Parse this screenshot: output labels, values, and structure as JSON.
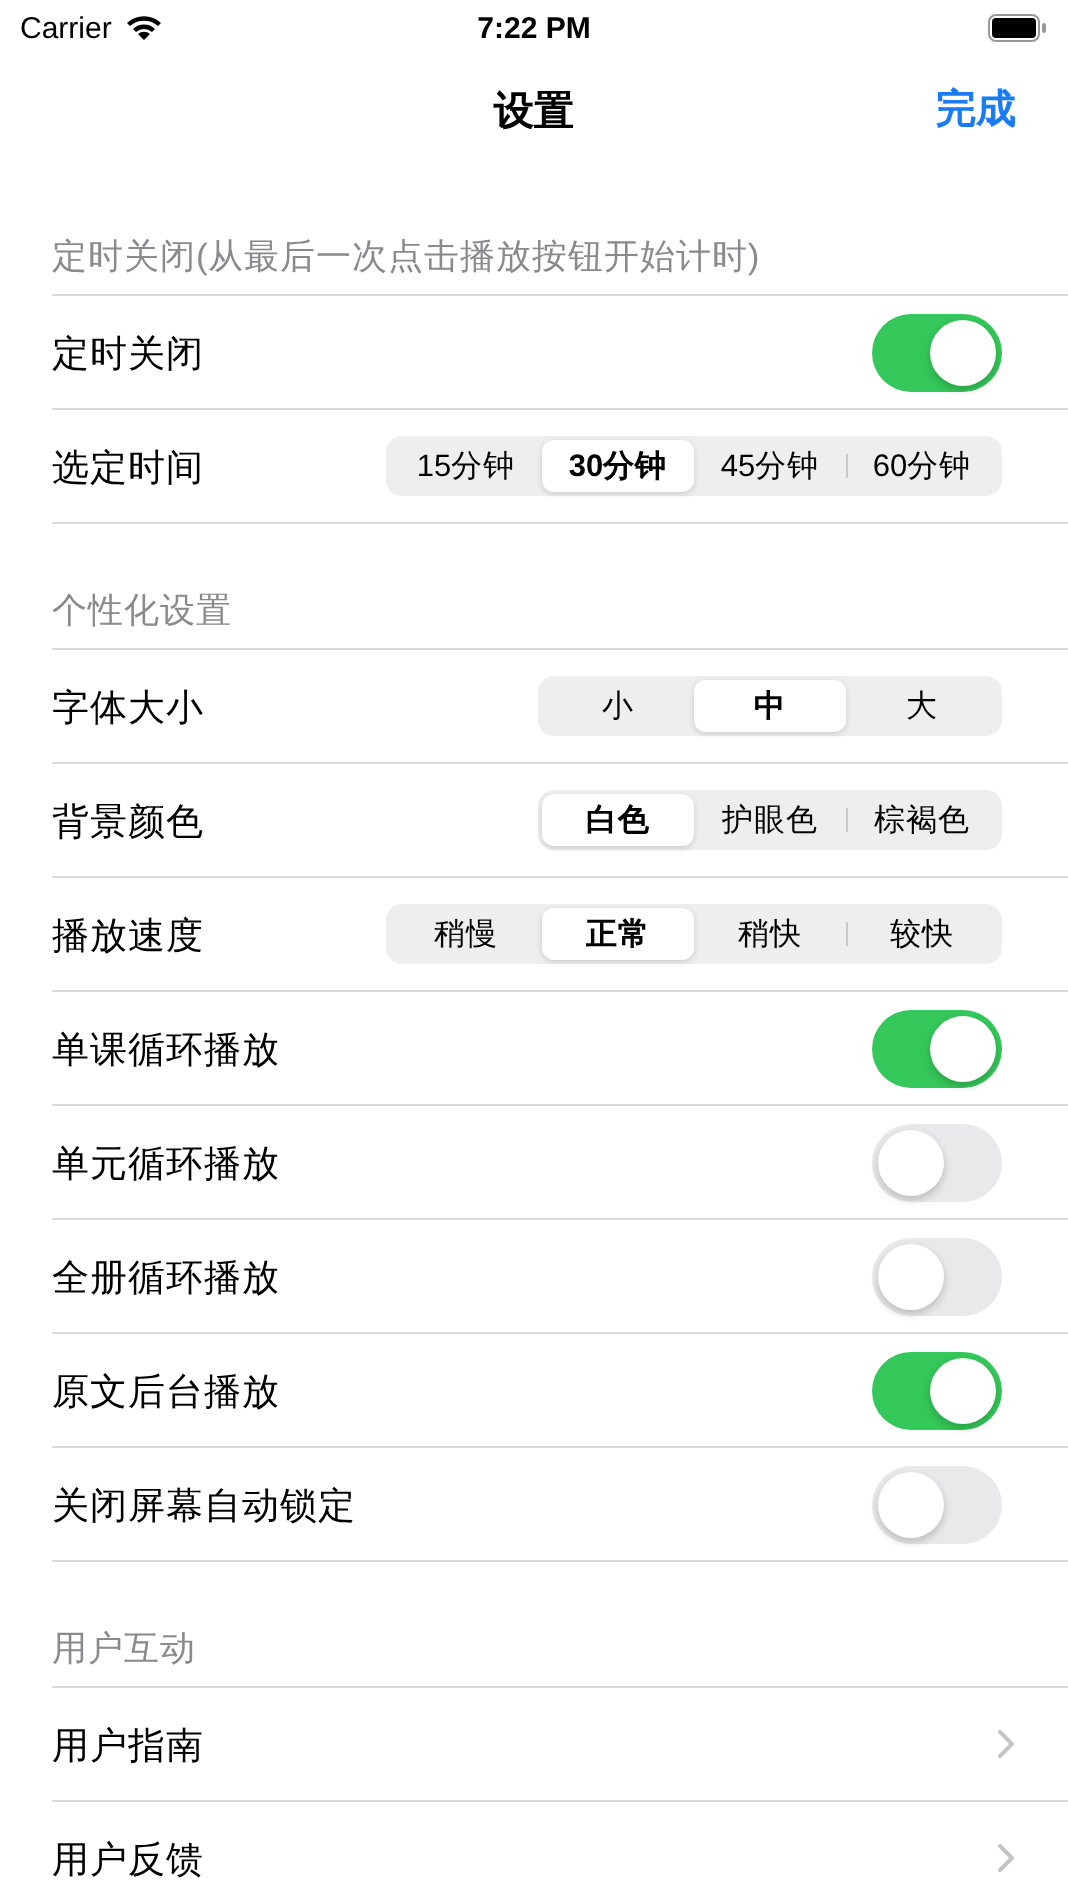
{
  "status_bar": {
    "carrier": "Carrier",
    "time": "7:22 PM"
  },
  "nav": {
    "title": "设置",
    "done": "完成"
  },
  "sections": [
    {
      "header": "定时关闭(从最后一次点击播放按钮开始计时)",
      "rows": [
        {
          "kind": "toggle",
          "label": "定时关闭",
          "on": true
        },
        {
          "kind": "segmented",
          "label": "选定时间",
          "options": [
            {
              "label": "15分钟",
              "selected": false
            },
            {
              "label": "30分钟",
              "selected": true
            },
            {
              "label": "45分钟",
              "selected": false
            },
            {
              "label": "60分钟",
              "selected": false
            }
          ]
        }
      ]
    },
    {
      "header": "个性化设置",
      "rows": [
        {
          "kind": "segmented",
          "label": "字体大小",
          "options": [
            {
              "label": "小",
              "selected": false
            },
            {
              "label": "中",
              "selected": true
            },
            {
              "label": "大",
              "selected": false
            }
          ]
        },
        {
          "kind": "segmented",
          "label": "背景颜色",
          "options": [
            {
              "label": "白色",
              "selected": true
            },
            {
              "label": "护眼色",
              "selected": false
            },
            {
              "label": "棕褐色",
              "selected": false
            }
          ]
        },
        {
          "kind": "segmented",
          "label": "播放速度",
          "options": [
            {
              "label": "稍慢",
              "selected": false
            },
            {
              "label": "正常",
              "selected": true
            },
            {
              "label": "稍快",
              "selected": false
            },
            {
              "label": "较快",
              "selected": false
            }
          ]
        },
        {
          "kind": "toggle",
          "label": "单课循环播放",
          "on": true
        },
        {
          "kind": "toggle",
          "label": "单元循环播放",
          "on": false
        },
        {
          "kind": "toggle",
          "label": "全册循环播放",
          "on": false
        },
        {
          "kind": "toggle",
          "label": "原文后台播放",
          "on": true
        },
        {
          "kind": "toggle",
          "label": "关闭屏幕自动锁定",
          "on": false
        }
      ]
    },
    {
      "header": "用户互动",
      "rows": [
        {
          "kind": "link",
          "label": "用户指南"
        },
        {
          "kind": "link",
          "label": "用户反馈"
        }
      ]
    }
  ]
}
